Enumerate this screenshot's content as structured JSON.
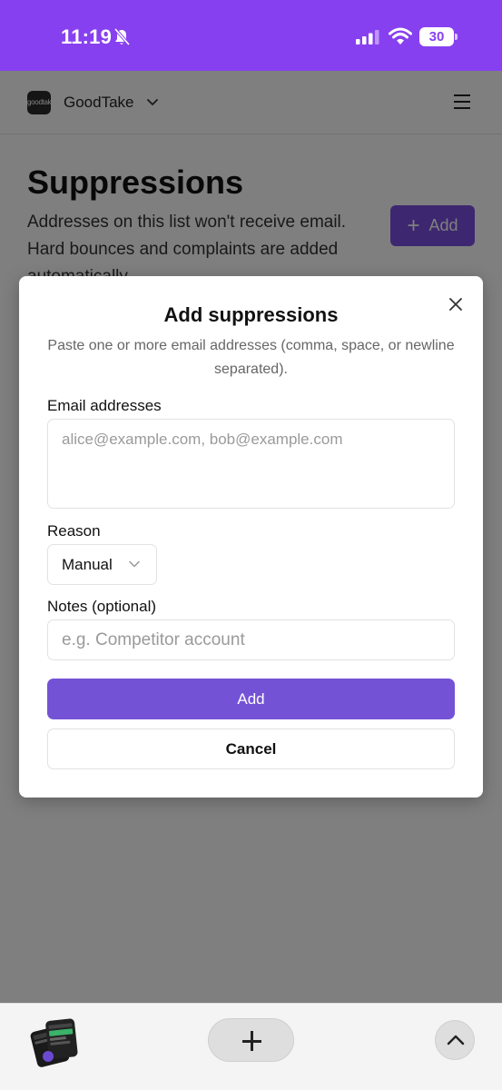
{
  "status_bar": {
    "time": "11:19",
    "battery": "30",
    "color": "#8740f0"
  },
  "nav": {
    "logo_text": "goodtake",
    "brand": "GoodTake"
  },
  "page": {
    "title": "Suppressions",
    "description": "Addresses on this list won't receive email. Hard bounces and complaints are added automatically.",
    "add_label": "Add",
    "add_icon": "+"
  },
  "modal": {
    "title": "Add suppressions",
    "description": "Paste one or more email addresses (comma, space, or newline separated).",
    "email_label": "Email addresses",
    "email_placeholder": "alice@example.com, bob@example.com",
    "reason_label": "Reason",
    "reason_value": "Manual",
    "notes_label": "Notes (optional)",
    "notes_placeholder": "e.g. Competitor account",
    "add_button": "Add",
    "cancel_button": "Cancel",
    "accent_color": "#7452d6"
  },
  "icons": {
    "silent": "bell-slash-icon",
    "signal": "signal-icon",
    "wifi": "wifi-icon",
    "close": "close-icon",
    "menu": "hamburger-icon",
    "new_tab": "plus-icon",
    "scroll_up": "chevron-up-icon"
  }
}
